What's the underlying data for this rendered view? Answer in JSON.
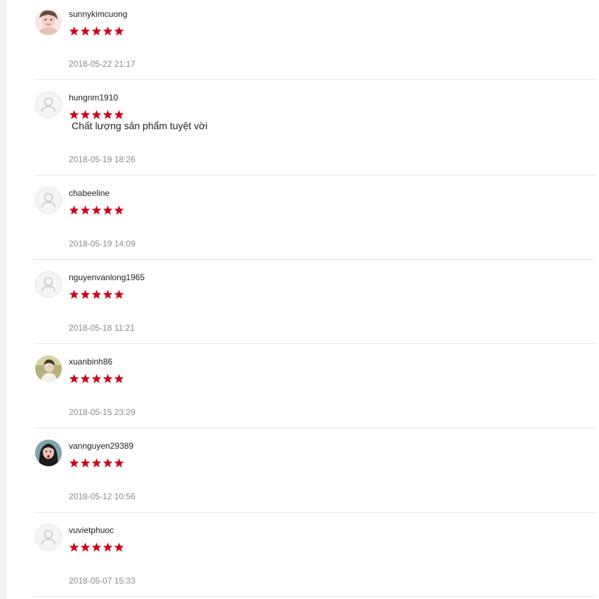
{
  "colors": {
    "star": "#d0011b",
    "username": "#222222",
    "timestamp": "#8a8a8a",
    "divider": "#e6e6e6"
  },
  "reviews": [
    {
      "username": "sunnykimcuong",
      "rating": 5,
      "comment": "",
      "timestamp": "2018-05-22 21:17",
      "avatar": "photo-avatar"
    },
    {
      "username": "hungnm1910",
      "rating": 5,
      "comment": "Chất lượng sản phẩm tuyệt vời",
      "timestamp": "2018-05-19 18:26",
      "avatar": "default-user-icon"
    },
    {
      "username": "chabeeline",
      "rating": 5,
      "comment": "",
      "timestamp": "2018-05-19 14:09",
      "avatar": "default-user-icon"
    },
    {
      "username": "nguyenvanlong1965",
      "rating": 5,
      "comment": "",
      "timestamp": "2018-05-18 11:21",
      "avatar": "default-user-icon"
    },
    {
      "username": "xuanbinh86",
      "rating": 5,
      "comment": "",
      "timestamp": "2018-05-15 23:29",
      "avatar": "photo-avatar"
    },
    {
      "username": "vannguyen29389",
      "rating": 5,
      "comment": "",
      "timestamp": "2018-05-12 10:56",
      "avatar": "photo-avatar"
    },
    {
      "username": "vuvietphuoc",
      "rating": 5,
      "comment": "",
      "timestamp": "2018-05-07 15:33",
      "avatar": "default-user-icon"
    }
  ]
}
